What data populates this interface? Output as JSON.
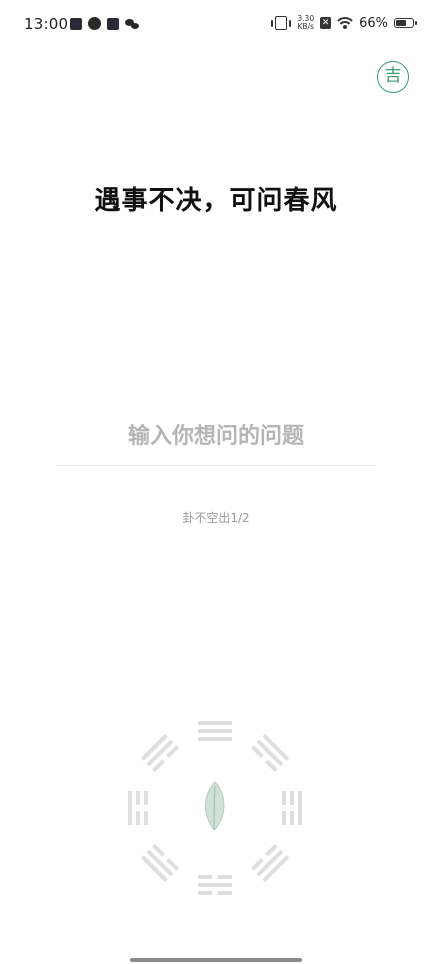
{
  "status_bar": {
    "time": "13:00",
    "net_speed_value": "3.30",
    "net_speed_unit": "KB/s",
    "battery_percent": "66%",
    "battery_level": 0.66,
    "icons": [
      "video-app-icon",
      "loop-app-icon",
      "mail-app-icon",
      "wechat-icon",
      "vibrate-icon",
      "sim-no-service-icon",
      "wifi-icon",
      "battery-icon"
    ]
  },
  "badge": {
    "label": "吉"
  },
  "headline": "遇事不决，可问春风",
  "question": {
    "placeholder": "输入你想问的问题",
    "value": ""
  },
  "counter": "卦不空出1/2",
  "colors": {
    "accent": "#3d9a72",
    "trigram": "#dedede",
    "leaf": "#cfe1d8"
  }
}
